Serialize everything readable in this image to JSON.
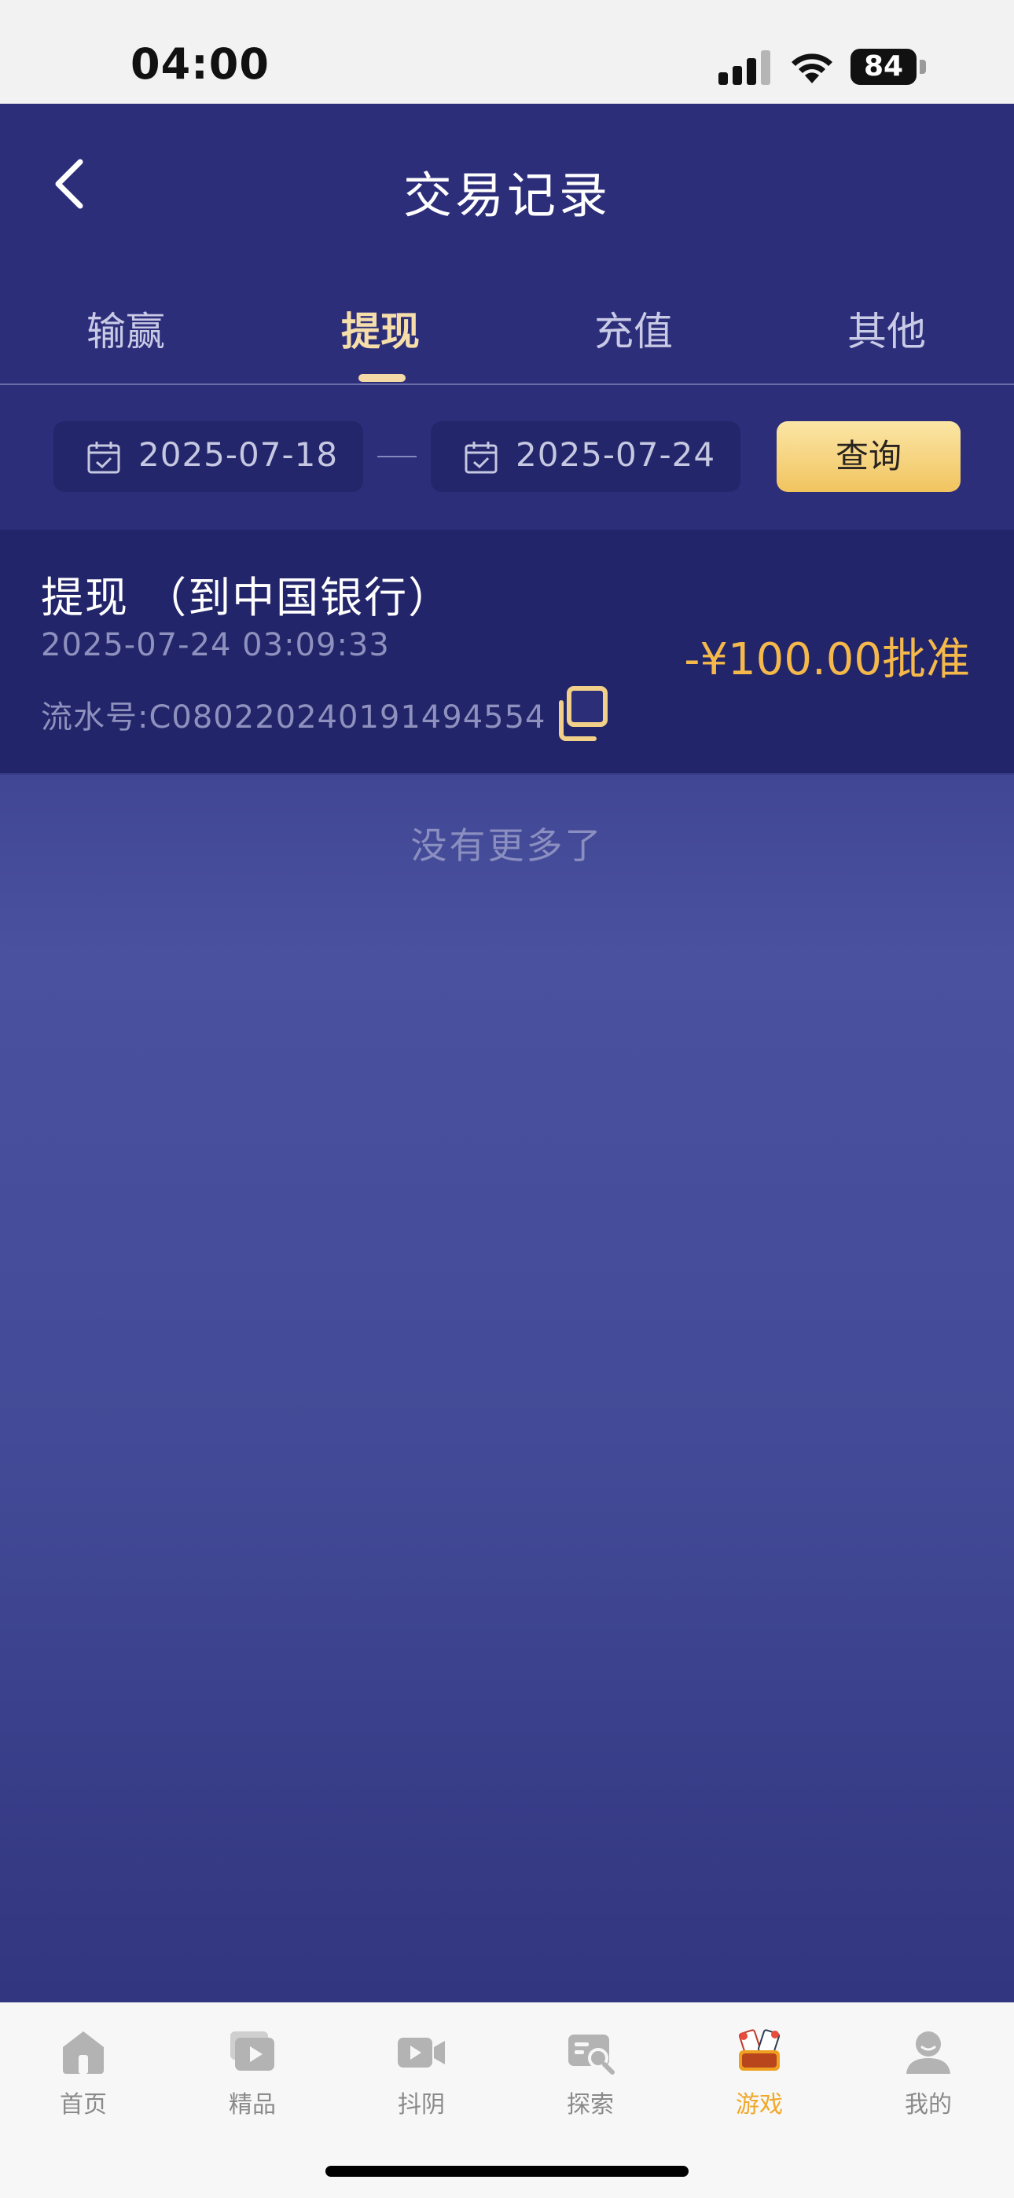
{
  "status_bar": {
    "time": "04:00",
    "battery": "84"
  },
  "header": {
    "title": "交易记录"
  },
  "tabs": [
    {
      "label": "输赢",
      "active": false
    },
    {
      "label": "提现",
      "active": true
    },
    {
      "label": "充值",
      "active": false
    },
    {
      "label": "其他",
      "active": false
    }
  ],
  "filter": {
    "start_date": "2025-07-18",
    "end_date": "2025-07-24",
    "query_label": "查询"
  },
  "records": [
    {
      "title": "提现 （到中国银行）",
      "time": "2025-07-24 03:09:33",
      "serial": "流水号:C080220240191494554",
      "amount": "-¥100.00批准"
    }
  ],
  "empty_text": "没有更多了",
  "bottom_nav": [
    {
      "label": "首页",
      "icon": "home-icon"
    },
    {
      "label": "精品",
      "icon": "video-library-icon"
    },
    {
      "label": "抖阴",
      "icon": "video-camera-icon"
    },
    {
      "label": "探索",
      "icon": "search-browse-icon"
    },
    {
      "label": "游戏",
      "icon": "game-cards-icon",
      "active": true
    },
    {
      "label": "我的",
      "icon": "user-icon"
    }
  ],
  "colors": {
    "accent": "#f5b84a",
    "tab_active": "#f6deaa",
    "header_bg": "#2d2e7a"
  }
}
